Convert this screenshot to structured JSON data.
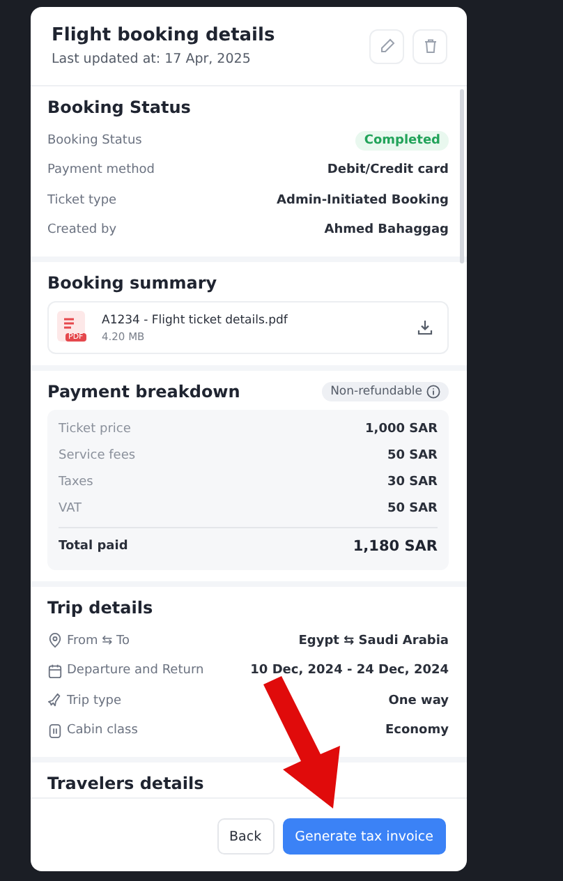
{
  "modal": {
    "title": "Flight booking details",
    "subtitle": "Last updated at: 17 Apr, 2025"
  },
  "booking_status": {
    "heading": "Booking Status",
    "rows": [
      {
        "label": "Booking Status",
        "value": "Completed",
        "kind": "badge"
      },
      {
        "label": "Payment method",
        "value": "Debit/Credit card",
        "kind": "text"
      },
      {
        "label": "Ticket type",
        "value": "Admin-Initiated Booking",
        "kind": "text"
      },
      {
        "label": "Created by",
        "value": "Ahmed Bahaggag",
        "kind": "text"
      }
    ]
  },
  "booking_summary": {
    "heading": "Booking summary",
    "file": {
      "name": "A1234 - Flight ticket details.pdf",
      "size": "4.20 MB",
      "badge": "PDF"
    }
  },
  "payment_breakdown": {
    "heading": "Payment breakdown",
    "tag": "Non-refundable",
    "rows": [
      {
        "label": "Ticket price",
        "value": "1,000 SAR"
      },
      {
        "label": "Service fees",
        "value": "50 SAR"
      },
      {
        "label": "Taxes",
        "value": "30 SAR"
      },
      {
        "label": "VAT",
        "value": "50 SAR"
      }
    ],
    "total": {
      "label": "Total paid",
      "value": "1,180 SAR"
    }
  },
  "trip_details": {
    "heading": "Trip details",
    "rows": [
      {
        "kind": "location",
        "label": "From ⇆ To",
        "value": "Egypt ⇆ Saudi Arabia"
      },
      {
        "kind": "calendar",
        "label": "Departure and Return",
        "value": "10 Dec, 2024 - 24 Dec, 2024"
      },
      {
        "kind": "plane",
        "label": "Trip type",
        "value": "One way"
      },
      {
        "kind": "seat",
        "label": "Cabin class",
        "value": "Economy"
      }
    ]
  },
  "travelers_details": {
    "heading": "Travelers details"
  },
  "footer": {
    "buttons": [
      {
        "label": "Back",
        "kind": "secondary"
      },
      {
        "label": "Generate tax invoice",
        "kind": "primary"
      }
    ]
  }
}
